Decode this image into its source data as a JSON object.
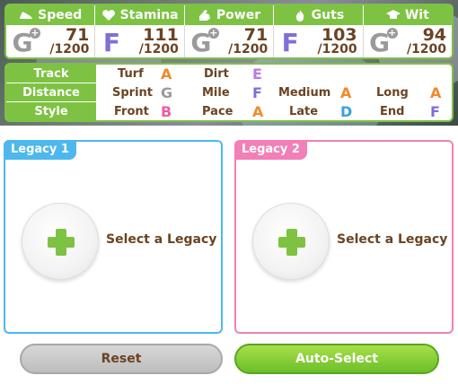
{
  "stats": [
    {
      "name": "Speed",
      "icon": "shoe-icon",
      "grade": "G",
      "plus": true,
      "value": "71",
      "max": "/1200"
    },
    {
      "name": "Stamina",
      "icon": "heart-icon",
      "grade": "F",
      "plus": false,
      "value": "111",
      "max": "/1200"
    },
    {
      "name": "Power",
      "icon": "muscle-icon",
      "grade": "G",
      "plus": true,
      "value": "71",
      "max": "/1200"
    },
    {
      "name": "Guts",
      "icon": "flame-icon",
      "grade": "F",
      "plus": false,
      "value": "103",
      "max": "/1200"
    },
    {
      "name": "Wit",
      "icon": "graduation-cap-icon",
      "grade": "G",
      "plus": true,
      "value": "94",
      "max": "/1200"
    }
  ],
  "aptitude": {
    "track_label": "Track",
    "distance_label": "Distance",
    "style_label": "Style",
    "track": [
      {
        "label": "Turf",
        "grade": "A"
      },
      {
        "label": "Dirt",
        "grade": "E"
      }
    ],
    "distance": [
      {
        "label": "Sprint",
        "grade": "G"
      },
      {
        "label": "Mile",
        "grade": "F"
      },
      {
        "label": "Medium",
        "grade": "A"
      },
      {
        "label": "Long",
        "grade": "A"
      }
    ],
    "style": [
      {
        "label": "Front",
        "grade": "B"
      },
      {
        "label": "Pace",
        "grade": "A"
      },
      {
        "label": "Late",
        "grade": "D"
      },
      {
        "label": "End",
        "grade": "F"
      }
    ]
  },
  "legacy": [
    {
      "tab": "Legacy 1",
      "select": "Select a Legacy"
    },
    {
      "tab": "Legacy 2",
      "select": "Select a Legacy"
    }
  ],
  "buttons": {
    "reset": "Reset",
    "auto_select": "Auto-Select"
  },
  "colors": {
    "accent_green": "#7dc242",
    "legacy1_blue": "#4db8ee",
    "legacy2_pink": "#f27fb7",
    "text_brown": "#6b4322"
  }
}
